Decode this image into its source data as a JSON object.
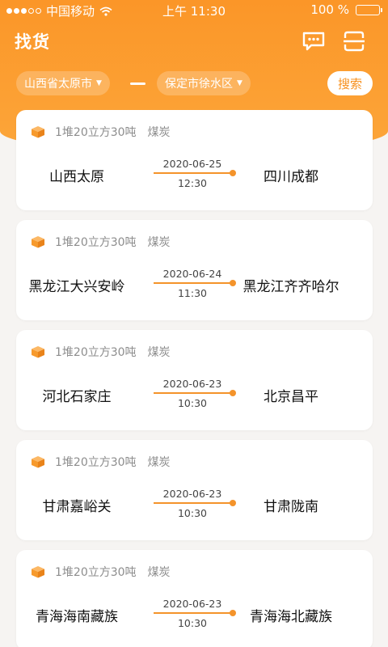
{
  "status_bar": {
    "carrier": "中国移动",
    "time": "上午 11:30",
    "battery_text": "100 %",
    "battery_level": 1.0
  },
  "header": {
    "title": "找货",
    "icons": [
      "message-icon",
      "scan-icon"
    ]
  },
  "filter": {
    "from_city": "山西省太原市",
    "to_city": "保定市徐水区",
    "search_label": "搜索"
  },
  "colors": {
    "accent": "#fb9628",
    "route": "#f4932a"
  },
  "orders": [
    {
      "spec": "1堆20立方30吨",
      "cargo": "煤炭",
      "origin": "山西太原",
      "destination": "四川成都",
      "date": "2020-06-25",
      "time": "12:30"
    },
    {
      "spec": "1堆20立方30吨",
      "cargo": "煤炭",
      "origin": "黑龙江大兴安岭",
      "destination": "黑龙江齐齐哈尔",
      "date": "2020-06-24",
      "time": "11:30"
    },
    {
      "spec": "1堆20立方30吨",
      "cargo": "煤炭",
      "origin": "河北石家庄",
      "destination": "北京昌平",
      "date": "2020-06-23",
      "time": "10:30"
    },
    {
      "spec": "1堆20立方30吨",
      "cargo": "煤炭",
      "origin": "甘肃嘉峪关",
      "destination": "甘肃陇南",
      "date": "2020-06-23",
      "time": "10:30"
    },
    {
      "spec": "1堆20立方30吨",
      "cargo": "煤炭",
      "origin": "青海海南藏族",
      "destination": "青海海北藏族",
      "date": "2020-06-23",
      "time": "10:30"
    }
  ]
}
